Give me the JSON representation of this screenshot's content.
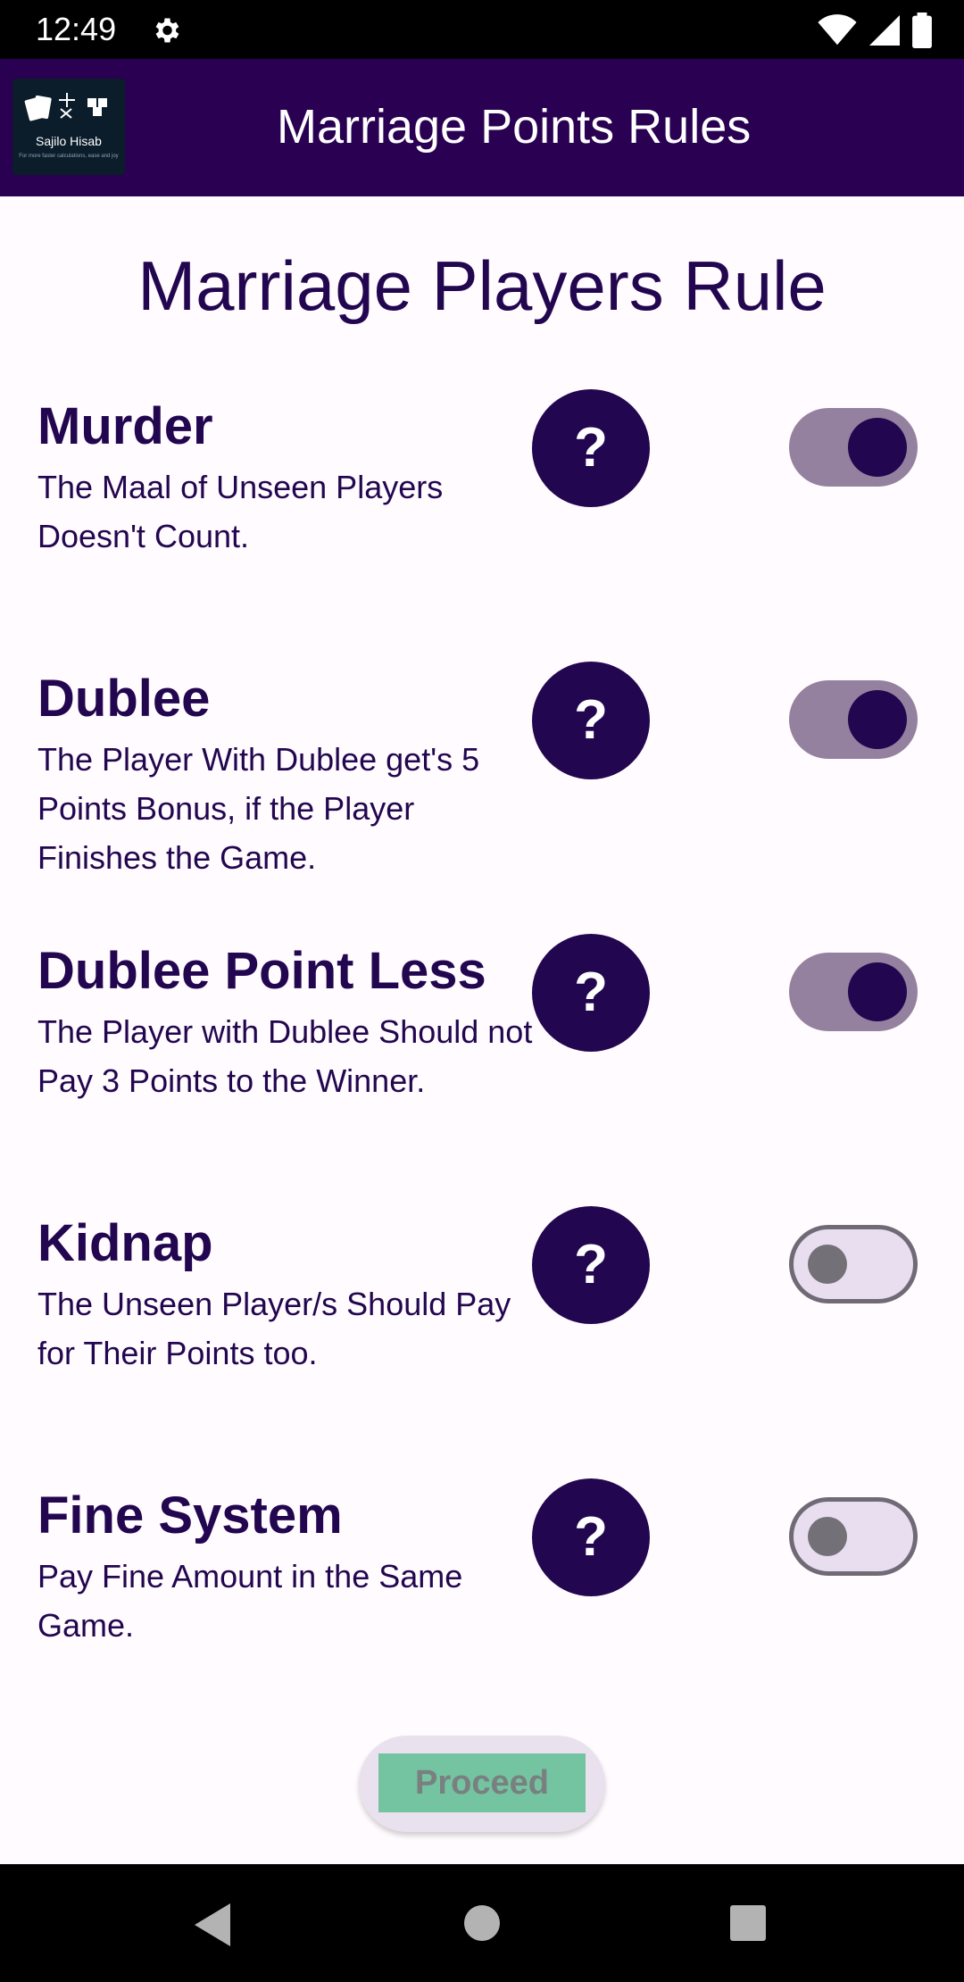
{
  "status_bar": {
    "time": "12:49"
  },
  "app_bar": {
    "title": "Marriage Points Rules",
    "logo_text": "Sajilo Hisab",
    "logo_subtext": "For more faster calculations, ease and joy"
  },
  "page": {
    "title": "Marriage Players Rule"
  },
  "rules": [
    {
      "title": "Murder",
      "description": "The Maal of Unseen Players Doesn't Count.",
      "help": "?",
      "enabled": true
    },
    {
      "title": "Dublee",
      "description": "The Player With Dublee get's 5 Points Bonus, if the Player Finishes the Game.",
      "help": "?",
      "enabled": true
    },
    {
      "title": "Dublee Point Less",
      "description": "The Player with Dublee Should not Pay 3 Points to the Winner.",
      "help": "?",
      "enabled": true
    },
    {
      "title": "Kidnap",
      "description": "The Unseen Player/s Should Pay for Their Points too.",
      "help": "?",
      "enabled": false
    },
    {
      "title": "Fine System",
      "description": "Pay Fine Amount in the Same Game.",
      "help": "?",
      "enabled": false
    }
  ],
  "actions": {
    "proceed_label": "Proceed"
  },
  "colors": {
    "app_bar": "#2A0052",
    "primary": "#22064F",
    "switch_on_track": "#94819F",
    "switch_off_track": "#E8DEF0",
    "proceed_bg": "#74C3A1"
  }
}
